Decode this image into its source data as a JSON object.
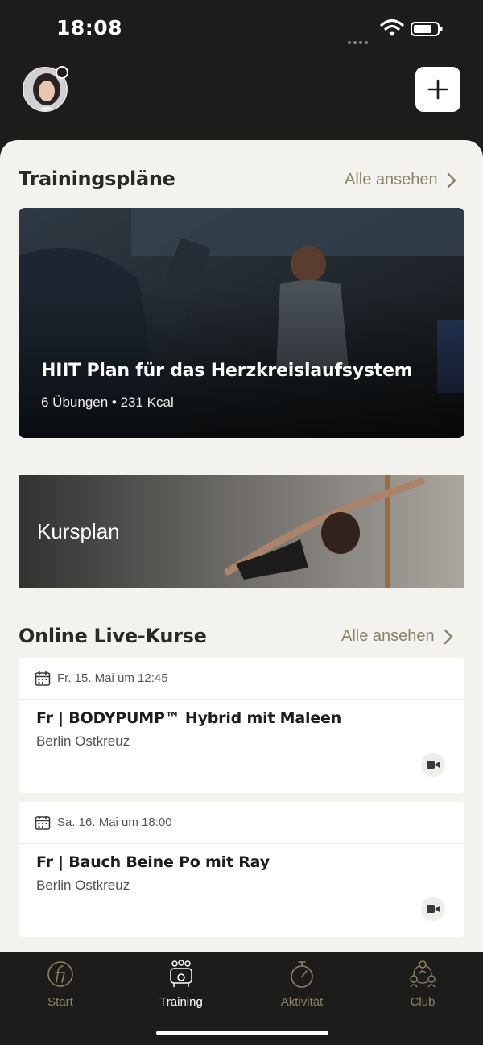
{
  "status_bar": {
    "time": "18:08"
  },
  "header": {
    "avatar": "avatar",
    "add_icon": "plus-icon"
  },
  "training_plans": {
    "title": "Trainingspläne",
    "see_all": "Alle ansehen",
    "card": {
      "title": "HIIT Plan für das Herzkreislaufsystem",
      "meta": "6 Übungen • 231 Kcal"
    }
  },
  "course_plan": {
    "label": "Kursplan"
  },
  "live_courses": {
    "title": "Online Live-Kurse",
    "see_all": "Alle ansehen",
    "items": [
      {
        "date": "Fr. 15. Mai um 12:45",
        "title": "Fr | BODYPUMP™ Hybrid mit Maleen",
        "location": "Berlin Ostkreuz"
      },
      {
        "date": "Sa. 16. Mai um 18:00",
        "title": "Fr | Bauch Beine Po mit Ray",
        "location": "Berlin Ostkreuz"
      }
    ]
  },
  "tab_bar": {
    "tabs": [
      {
        "label": "Start",
        "icon": "brand-logo-icon"
      },
      {
        "label": "Training",
        "icon": "training-icon",
        "active": true
      },
      {
        "label": "Aktivität",
        "icon": "stopwatch-icon"
      },
      {
        "label": "Club",
        "icon": "club-icon"
      }
    ]
  },
  "colors": {
    "accent": "#8b8364",
    "background": "#1e1c1a",
    "sheet": "#f3f2ef"
  }
}
